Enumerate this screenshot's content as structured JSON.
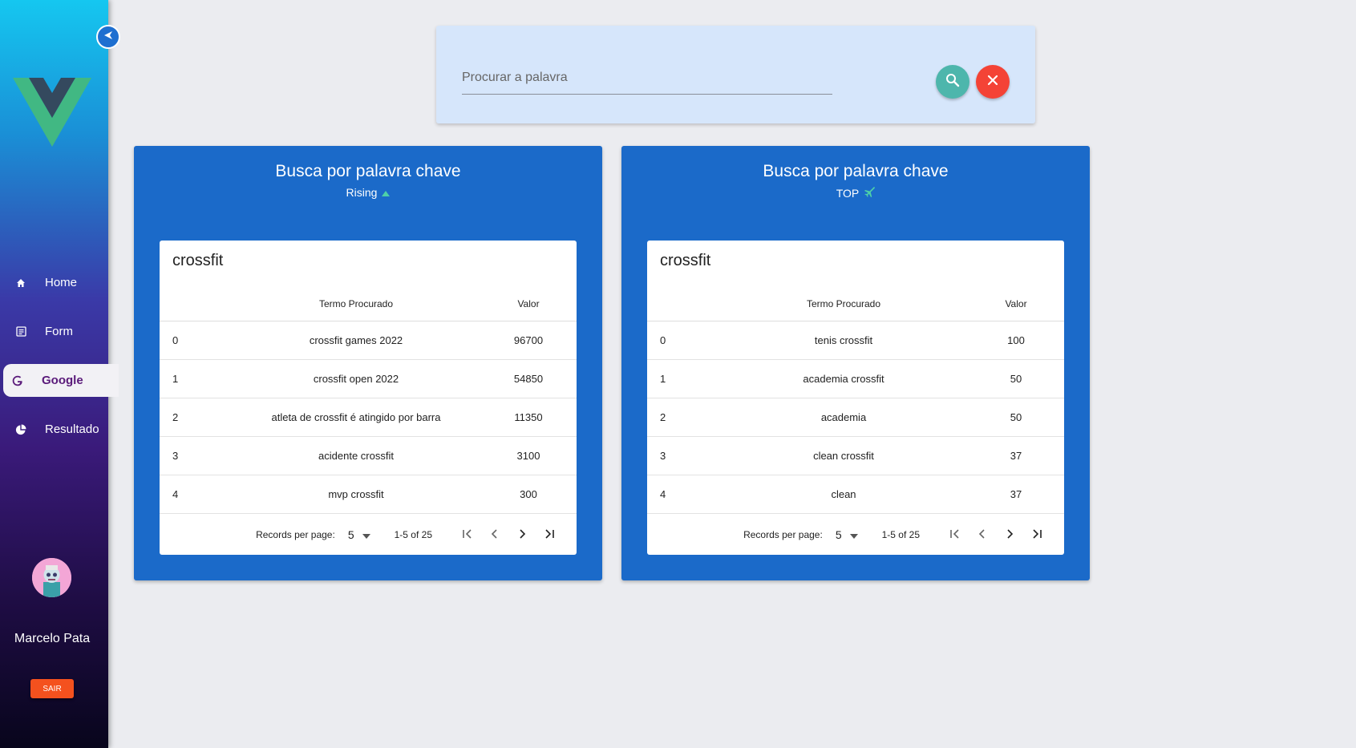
{
  "sidebar": {
    "items": [
      {
        "label": "Home",
        "icon": "home-icon"
      },
      {
        "label": "Form",
        "icon": "form-icon"
      },
      {
        "label": "Google",
        "icon": "google-icon",
        "active": true
      },
      {
        "label": "Resultado",
        "icon": "chart-pie-icon"
      }
    ],
    "user_name": "Marcelo Pata",
    "logout_label": "SAIR"
  },
  "search": {
    "placeholder": "Procurar a palavra",
    "value": ""
  },
  "panels": [
    {
      "title": "Busca por palavra chave",
      "subtitle": "Rising",
      "subtitle_icon": "arrow-up-icon",
      "table_title": "crossfit",
      "columns": [
        "",
        "Termo Procurado",
        "Valor"
      ],
      "rows": [
        {
          "index": "0",
          "term": "crossfit games 2022",
          "value": "96700"
        },
        {
          "index": "1",
          "term": "crossfit open 2022",
          "value": "54850"
        },
        {
          "index": "2",
          "term": "atleta de crossfit é atingido por barra",
          "value": "11350"
        },
        {
          "index": "3",
          "term": "acidente crossfit",
          "value": "3100"
        },
        {
          "index": "4",
          "term": "mvp crossfit",
          "value": "300"
        }
      ],
      "records_per_page_label": "Records per page:",
      "records_per_page": "5",
      "range": "1-5 of 25"
    },
    {
      "title": "Busca por palavra chave",
      "subtitle": "TOP",
      "subtitle_icon": "airplane-icon",
      "table_title": "crossfit",
      "columns": [
        "",
        "Termo Procurado",
        "Valor"
      ],
      "rows": [
        {
          "index": "0",
          "term": "tenis crossfit",
          "value": "100"
        },
        {
          "index": "1",
          "term": "academia crossfit",
          "value": "50"
        },
        {
          "index": "2",
          "term": "academia",
          "value": "50"
        },
        {
          "index": "3",
          "term": "clean crossfit",
          "value": "37"
        },
        {
          "index": "4",
          "term": "clean",
          "value": "37"
        }
      ],
      "records_per_page_label": "Records per page:",
      "records_per_page": "5",
      "range": "1-5 of 25"
    }
  ],
  "colors": {
    "panel_bg": "#1b6ac9",
    "search_btn": "#4db6ac",
    "clear_btn": "#f44336",
    "accent_green": "#4dd0a8"
  }
}
